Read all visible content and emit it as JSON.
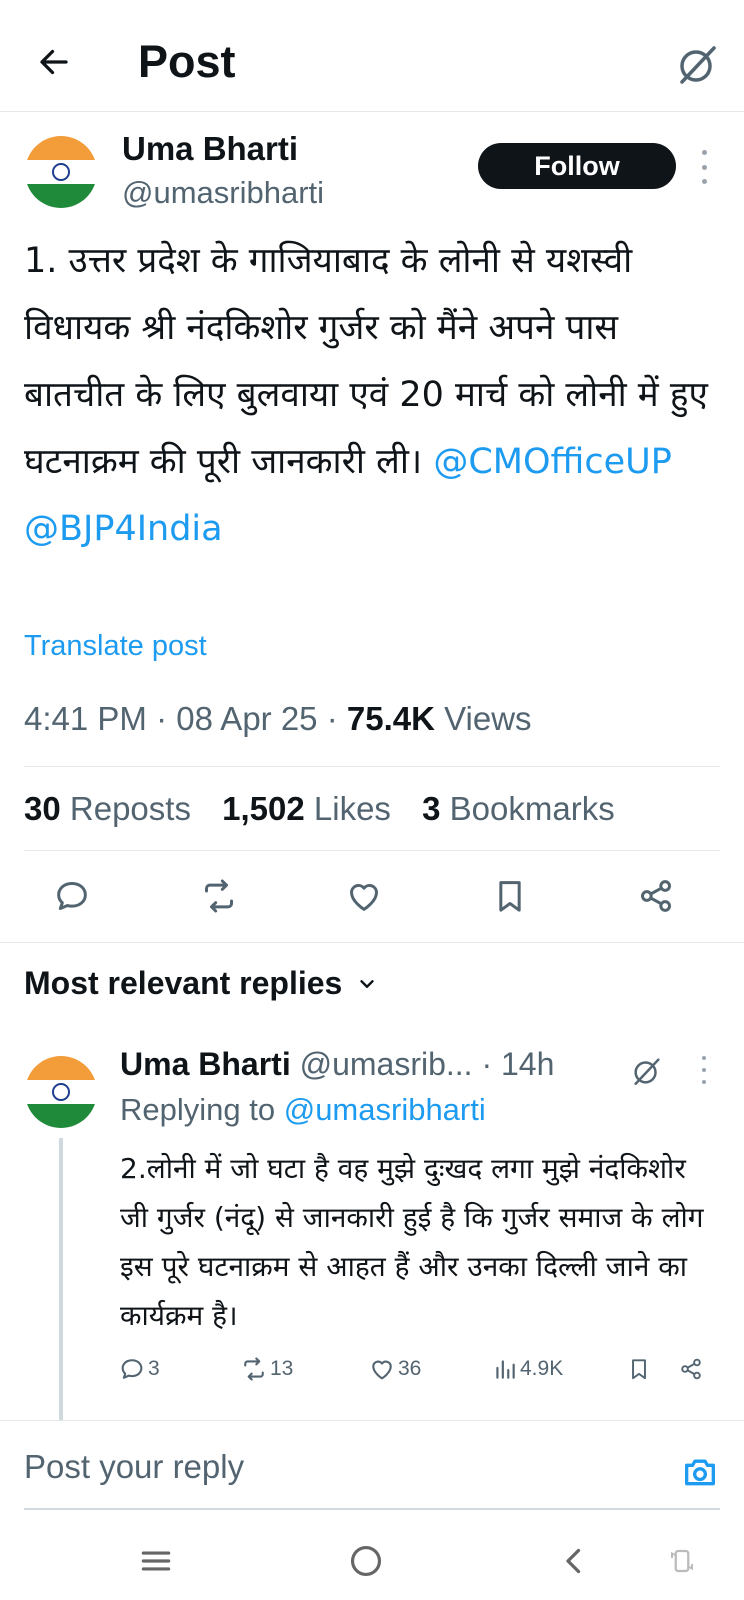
{
  "header": {
    "title": "Post",
    "back_icon": "arrow-left-icon",
    "grok_icon": "grok-icon"
  },
  "post": {
    "author_name": "Uma Bharti",
    "author_handle": "@umasribharti",
    "follow_label": "Follow",
    "text_plain": "1. उत्तर प्रदेश के गाजियाबाद के लोनी से यशस्वी विधायक श्री नंदकिशोर गुर्जर को मैंने अपने पास बातचीत के लिए बुलवाया एवं 20 मार्च को लोनी में हुए घटनाक्रम की पूरी जानकारी ली।",
    "mention_1": "@CMOfficeUP",
    "mention_2": "@BJP4India",
    "translate_label": "Translate post",
    "time": "4:41 PM",
    "date": "08 Apr 25",
    "views_count": "75.4K",
    "views_label": "Views",
    "reposts_count": "30",
    "reposts_label": "Reposts",
    "likes_count": "1,502",
    "likes_label": "Likes",
    "bookmarks_count": "3",
    "bookmarks_label": "Bookmarks"
  },
  "replies": {
    "sort_label": "Most relevant replies",
    "items": [
      {
        "name": "Uma Bharti",
        "handle": "@umasrib...",
        "time": "· 14h",
        "replying_prefix": "Replying to",
        "replying_handle": "@umasribharti",
        "text": "2.लोनी में जो घटा है वह मुझे दुःखद लगा मुझे नंदकिशोर जी गुर्जर (नंदू) से जानकारी हुई है कि गुर्जर समाज के लोग इस पूरे घटनाक्रम से आहत हैं और उनका दिल्ली जाने का कार्यक्रम है।",
        "reply_count": "3",
        "repost_count": "13",
        "like_count": "36",
        "view_count": "4.9K"
      }
    ]
  },
  "composer": {
    "placeholder": "Post your reply"
  },
  "colors": {
    "link": "#1d9bf0",
    "text": "#0f1419",
    "secondary": "#536471",
    "follow_bg": "#0f1419"
  }
}
